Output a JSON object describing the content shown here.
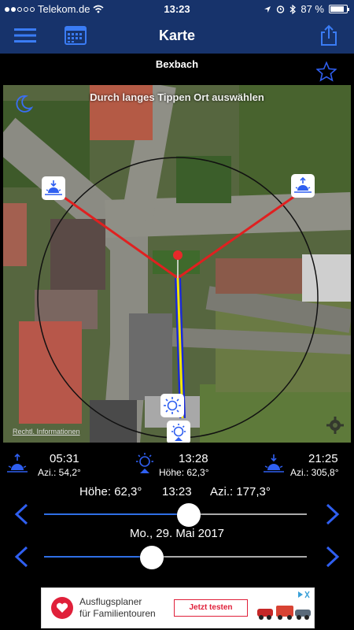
{
  "status": {
    "carrier": "Telekom.de",
    "time": "13:23",
    "battery": "87 %",
    "battery_level": 0.87
  },
  "nav": {
    "title": "Karte",
    "menu_icon": "hamburger-icon",
    "calendar_icon": "calendar-icon",
    "share_icon": "share-icon"
  },
  "location": {
    "name": "Bexbach",
    "favorite_icon": "star-icon"
  },
  "map": {
    "hint": "Durch langes Tippen Ort auswählen",
    "legal": "Rechtl. Informationen",
    "moon_icon": "moon-icon",
    "settings_icon": "gear-icon"
  },
  "sunrise": {
    "time": "05:31",
    "azimuth": "Azi.: 54,2°",
    "icon": "sunrise-icon"
  },
  "noon": {
    "time": "13:28",
    "altitude": "Höhe: 62,3°",
    "icon": "solar-noon-icon"
  },
  "sunset": {
    "time": "21:25",
    "azimuth": "Azi.: 305,8°",
    "icon": "sunset-icon"
  },
  "current": {
    "altitude": "Höhe: 62,3°",
    "time": "13:23",
    "azimuth": "Azi.: 177,3°"
  },
  "time_slider": {
    "position": 0.55
  },
  "date": "Mo., 29. Mai 2017",
  "date_slider": {
    "position": 0.41
  },
  "ad": {
    "line1": "Ausflugsplaner",
    "line2": "für Familientouren",
    "cta": "Jetzt testen"
  },
  "colors": {
    "bar": "#17336b",
    "accent": "#2f6fe6",
    "sunrise_line": "#e02020",
    "sun_line": "#f2e600",
    "shadow_line": "#1a2ad8"
  }
}
